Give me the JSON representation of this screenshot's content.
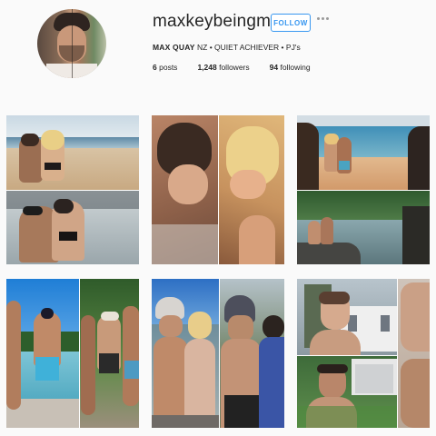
{
  "profile": {
    "username": "maxkeybeingme",
    "follow_label": "FOLLOW",
    "more_icon": "more-horizontal-icon",
    "bio_name": "MAX QUAY",
    "bio_rest": " NZ • QUIET ACHIEVER • PJ's",
    "stats": {
      "posts_count": "6",
      "posts_label": "posts",
      "followers_count": "1,248",
      "followers_label": "followers",
      "following_count": "94",
      "following_label": "following"
    }
  },
  "colors": {
    "accent": "#3897f0",
    "text": "#262626",
    "background": "#fafafa"
  },
  "posts": [
    {
      "name": "post-beach-couple-collage"
    },
    {
      "name": "post-couple-closeup-collage"
    },
    {
      "name": "post-rocky-coast-collage"
    },
    {
      "name": "post-pool-friends-collage"
    },
    {
      "name": "post-beanie-group-collage"
    },
    {
      "name": "post-selfie-house-collage"
    }
  ]
}
